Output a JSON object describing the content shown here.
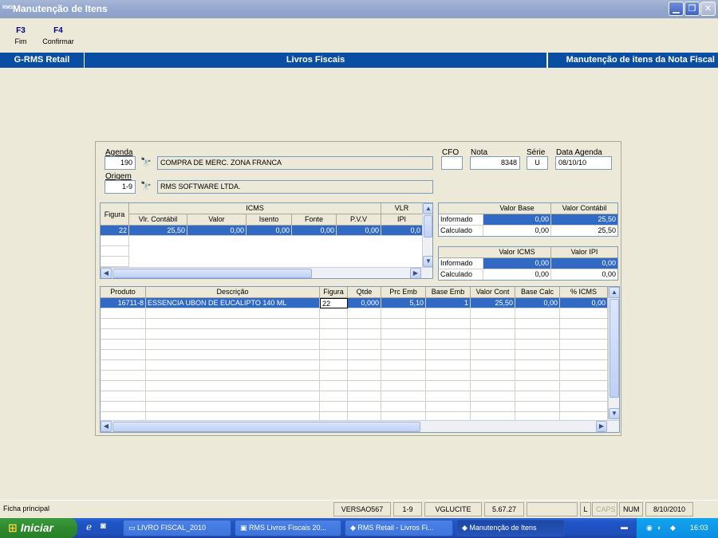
{
  "window": {
    "title": "Manutenção de Itens",
    "logo": "RMS"
  },
  "fkeys": [
    {
      "key": "F3",
      "label": "Fim"
    },
    {
      "key": "F4",
      "label": "Confirmar"
    }
  ],
  "band": {
    "left": "G-RMS Retail",
    "center": "Livros Fiscais",
    "right": "Manutenção de itens da Nota Fiscal"
  },
  "form": {
    "agenda_label": "Agenda",
    "agenda_value": "190",
    "agenda_desc": "COMPRA DE MERC. ZONA FRANCA",
    "origem_label": "Origem",
    "origem_value": "1-9",
    "origem_desc": "RMS SOFTWARE LTDA.",
    "cfo_label": "CFO",
    "cfo_value": "",
    "nota_label": "Nota",
    "nota_value": "8348",
    "serie_label": "Série",
    "serie_value": "U",
    "data_label": "Data Agenda",
    "data_value": "08/10/10"
  },
  "icms_grid": {
    "figura_header": "Figura",
    "icms_group": "ICMS",
    "vlr_group": "VLR",
    "columns": [
      "Vlr. Contábil",
      "Valor",
      "Isento",
      "Fonte",
      "P.V.V",
      "IPI"
    ],
    "row": {
      "figura": "22",
      "values": [
        "25,50",
        "0,00",
        "0,00",
        "0,00",
        "0,00",
        "0,0"
      ]
    }
  },
  "base_box": {
    "headers": [
      "Valor Base",
      "Valor Contábil"
    ],
    "rows": [
      {
        "label": "Informado",
        "values": [
          "0,00",
          "25,50"
        ]
      },
      {
        "label": "Calculado",
        "values": [
          "0,00",
          "25,50"
        ]
      }
    ]
  },
  "icms_box": {
    "headers": [
      "Valor ICMS",
      "Valor IPI"
    ],
    "rows": [
      {
        "label": "Informado",
        "values": [
          "0,00",
          "0,00"
        ]
      },
      {
        "label": "Calculado",
        "values": [
          "0,00",
          "0,00"
        ]
      }
    ]
  },
  "items_grid": {
    "columns": [
      "Produto",
      "Descrição",
      "Figura",
      "Qtde",
      "Prc Emb",
      "Base Emb",
      "Valor Cont",
      "Base Calc",
      "% ICMS"
    ],
    "row": [
      "16711-8",
      "ESSENCIA UBON DE EUCALIPTO 140 ML",
      "22",
      "0,000",
      "5,10",
      "1",
      "25,50",
      "0,00",
      "0,00"
    ]
  },
  "status": {
    "main": "Ficha principal",
    "versao": "VERSAO567",
    "loja": "1-9",
    "user": "VGLUCITE",
    "build": "5.67.27",
    "l": "L",
    "caps": "CAPS",
    "num": "NUM",
    "date": "8/10/2010"
  },
  "taskbar": {
    "start": "Iniciar",
    "buttons": [
      "LIVRO FISCAL_2010",
      "RMS Livros Fiscais 20...",
      "RMS Retail - Livros Fi...",
      "Manutenção de Itens"
    ],
    "clock": "16:03"
  }
}
